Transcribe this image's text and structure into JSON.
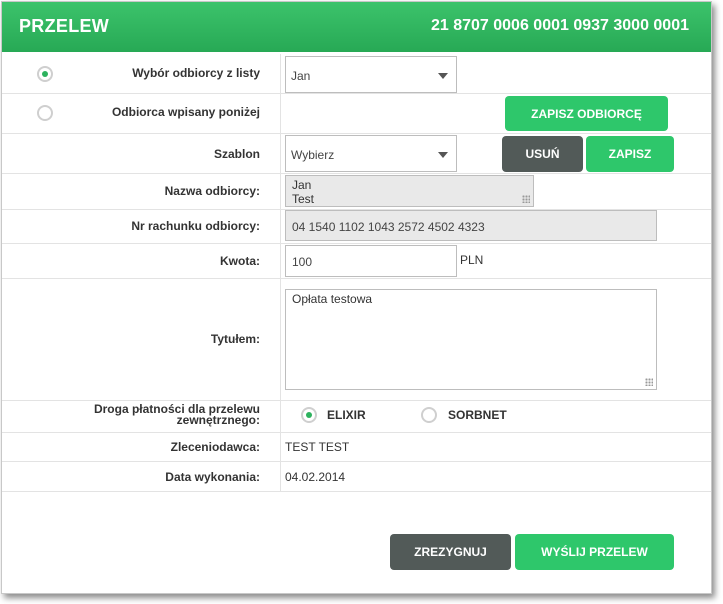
{
  "header": {
    "title": "PRZELEW",
    "account": "21 8707 0006 0001 0937 3000 0001"
  },
  "recipient_choice": {
    "from_list_label": "Wybór odbiorcy z listy",
    "from_list_selected": true,
    "from_list_value": "Jan",
    "manual_label": "Odbiorca wpisany poniżej",
    "manual_selected": false,
    "save_recipient_button": "ZAPISZ ODBIORCĘ"
  },
  "template": {
    "label": "Szablon",
    "value": "Wybierz",
    "delete_button": "USUŃ",
    "save_button": "ZAPISZ"
  },
  "recipient_name": {
    "label": "Nazwa odbiorcy:",
    "line1": "Jan",
    "line2": "Test"
  },
  "account_number": {
    "label": "Nr rachunku odbiorcy:",
    "value": "04 1540 1102 1043 2572 4502 4323"
  },
  "amount": {
    "label": "Kwota:",
    "value": "100",
    "currency": "PLN"
  },
  "title": {
    "label": "Tytułem:",
    "value": "Opłata testowa"
  },
  "payment_route": {
    "label": "Droga płatności dla przelewu zewnętrznego:",
    "options": [
      {
        "label": "ELIXIR",
        "selected": true
      },
      {
        "label": "SORBNET",
        "selected": false
      }
    ]
  },
  "orderer": {
    "label": "Zleceniodawca:",
    "value": "TEST TEST"
  },
  "execution_date": {
    "label": "Data wykonania:",
    "value": "04.02.2014"
  },
  "footer": {
    "cancel_button": "ZREZYGNUJ",
    "send_button": "WYŚLIJ PRZELEW"
  },
  "colors": {
    "accent": "#2ec76b",
    "dark_button": "#525a58"
  }
}
